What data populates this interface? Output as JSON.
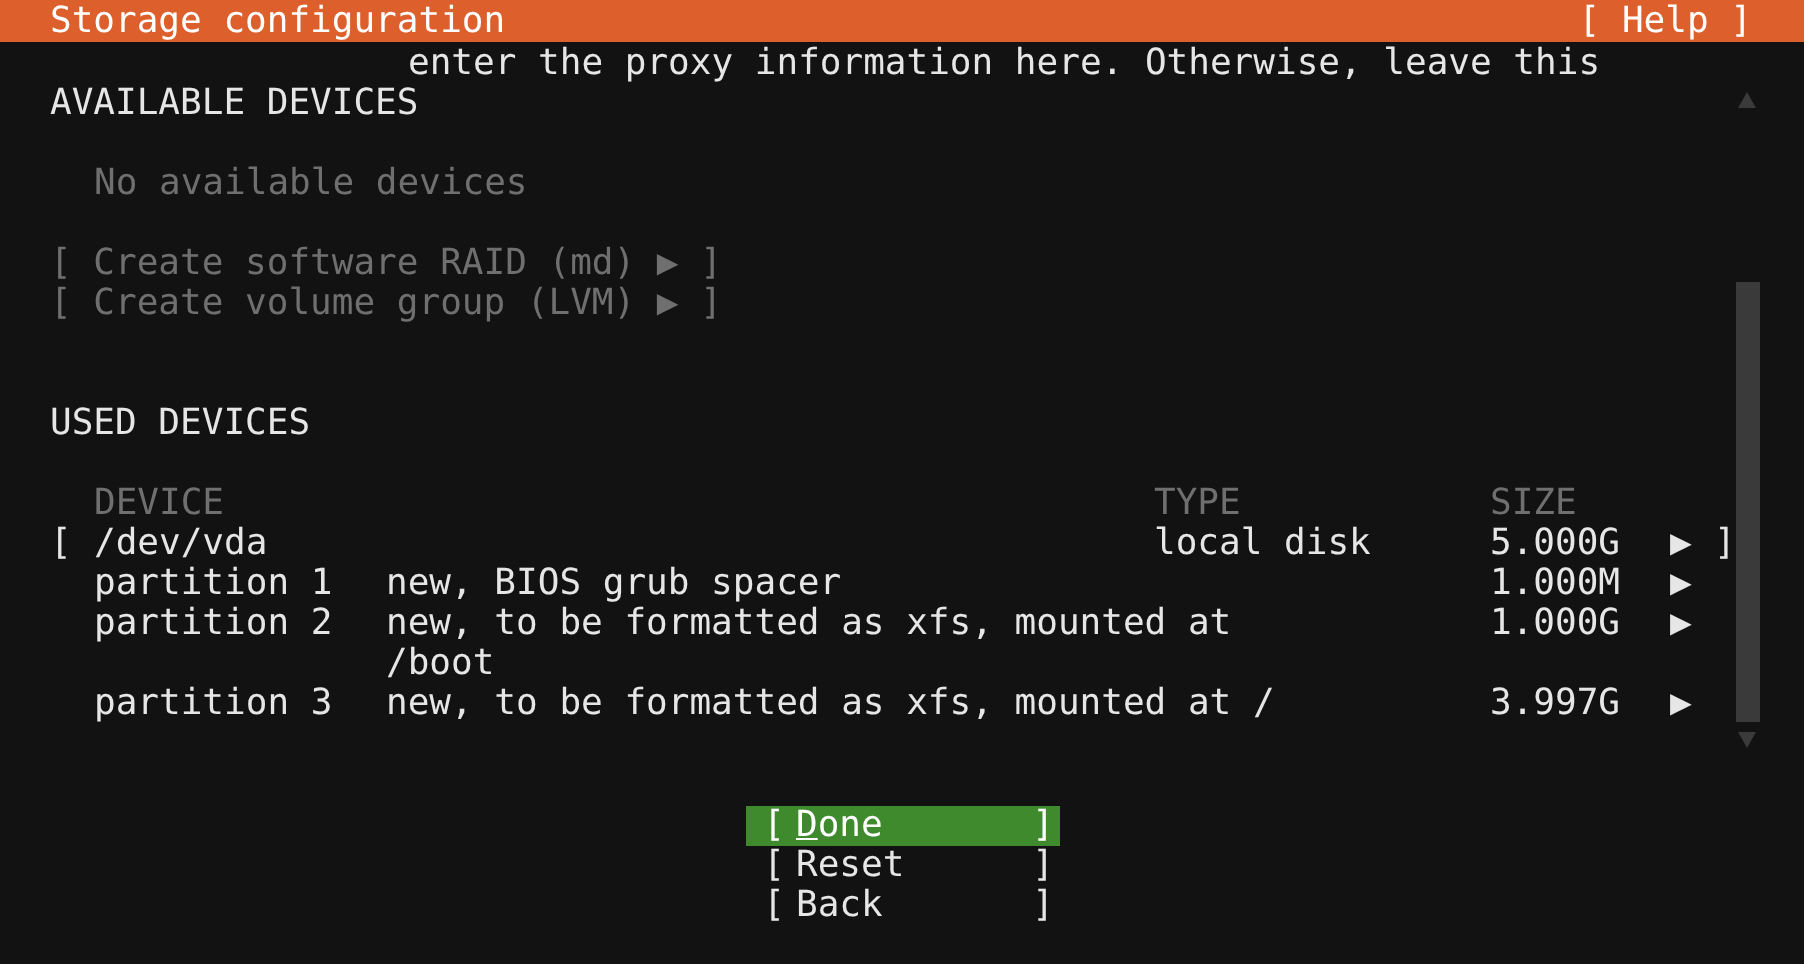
{
  "header": {
    "title": "Storage configuration",
    "help": "[ Help ]"
  },
  "stray_text": "enter the proxy information here. Otherwise, leave this",
  "available": {
    "heading": "AVAILABLE DEVICES",
    "empty": "No available devices",
    "actions": [
      {
        "label": "[ Create software RAID (md) ▶ ]",
        "disabled": true
      },
      {
        "label": "[ Create volume group (LVM) ▶ ]",
        "disabled": true
      }
    ]
  },
  "used": {
    "heading": "USED DEVICES",
    "columns": [
      "DEVICE",
      "TYPE",
      "SIZE"
    ],
    "rows": [
      {
        "kind": "disk",
        "open": "[",
        "device": "/dev/vda",
        "type": "local disk",
        "size": "5.000G",
        "arrow": "▶",
        "close": "]"
      },
      {
        "kind": "partition",
        "device": "partition 1",
        "description": "new, BIOS grub spacer",
        "size": "1.000M",
        "arrow": "▶"
      },
      {
        "kind": "partition",
        "device": "partition 2",
        "description": "new, to be formatted as xfs, mounted at /boot",
        "size": "1.000G",
        "arrow": "▶"
      },
      {
        "kind": "partition",
        "device": "partition 3",
        "description": "new, to be formatted as xfs, mounted at /",
        "size": "3.997G",
        "arrow": "▶"
      }
    ]
  },
  "buttons": [
    {
      "open": "[",
      "label": "Done",
      "close": "]",
      "selected": true,
      "accelerator": true
    },
    {
      "open": "[",
      "label": "Reset",
      "close": "]",
      "selected": false,
      "accelerator": false
    },
    {
      "open": "[",
      "label": "Back",
      "close": "]",
      "selected": false,
      "accelerator": false
    }
  ]
}
